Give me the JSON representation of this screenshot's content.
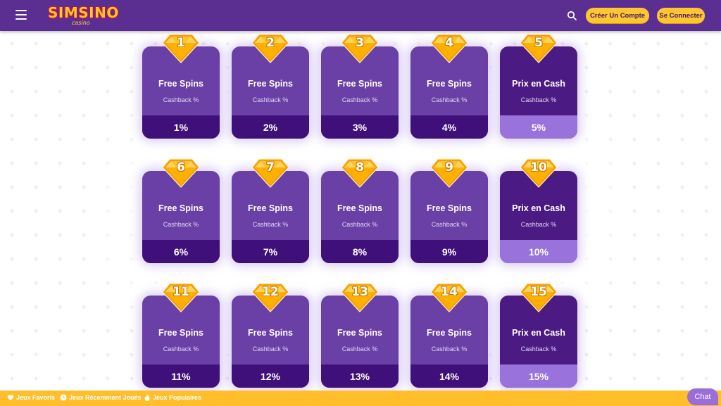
{
  "header": {
    "logo_text": "SIMSINO",
    "logo_sub": "casino",
    "register_label": "Créer Un Compte",
    "login_label": "Se Connecter"
  },
  "colors": {
    "header_bg": "#5b2e91",
    "accent": "#ffc533",
    "card_bg": "#6a3fa6",
    "card_cash_bg": "#4b1a82",
    "footer_bg": "#ffbe2a"
  },
  "levels": [
    {
      "num": "1",
      "title": "Free Spins",
      "sub": "Cashback %",
      "pct": "1%",
      "type": "spins"
    },
    {
      "num": "2",
      "title": "Free Spins",
      "sub": "Cashback %",
      "pct": "2%",
      "type": "spins"
    },
    {
      "num": "3",
      "title": "Free Spins",
      "sub": "Cashback %",
      "pct": "3%",
      "type": "spins"
    },
    {
      "num": "4",
      "title": "Free Spins",
      "sub": "Cashback %",
      "pct": "4%",
      "type": "spins"
    },
    {
      "num": "5",
      "title": "Prix en Cash",
      "sub": "Cashback %",
      "pct": "5%",
      "type": "cash"
    },
    {
      "num": "6",
      "title": "Free Spins",
      "sub": "Cashback %",
      "pct": "6%",
      "type": "spins"
    },
    {
      "num": "7",
      "title": "Free Spins",
      "sub": "Cashback %",
      "pct": "7%",
      "type": "spins"
    },
    {
      "num": "8",
      "title": "Free Spins",
      "sub": "Cashback %",
      "pct": "8%",
      "type": "spins"
    },
    {
      "num": "9",
      "title": "Free Spins",
      "sub": "Cashback %",
      "pct": "9%",
      "type": "spins"
    },
    {
      "num": "10",
      "title": "Prix en Cash",
      "sub": "Cashback %",
      "pct": "10%",
      "type": "cash"
    },
    {
      "num": "11",
      "title": "Free Spins",
      "sub": "Cashback %",
      "pct": "11%",
      "type": "spins"
    },
    {
      "num": "12",
      "title": "Free Spins",
      "sub": "Cashback %",
      "pct": "12%",
      "type": "spins"
    },
    {
      "num": "13",
      "title": "Free Spins",
      "sub": "Cashback %",
      "pct": "13%",
      "type": "spins"
    },
    {
      "num": "14",
      "title": "Free Spins",
      "sub": "Cashback %",
      "pct": "14%",
      "type": "spins"
    },
    {
      "num": "15",
      "title": "Prix en Cash",
      "sub": "Cashback %",
      "pct": "15%",
      "type": "cash"
    }
  ],
  "footer": {
    "favorites_label": "Jeux Favoris",
    "recent_label": "Jeux Récemment Joués",
    "popular_label": "Jeux Populaires"
  },
  "chat_label": "Chat"
}
